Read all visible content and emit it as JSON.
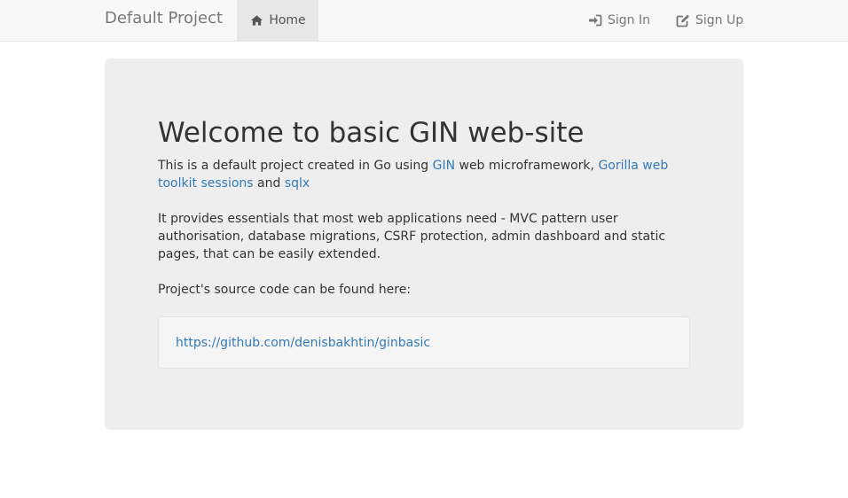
{
  "navbar": {
    "brand": "Default Project",
    "home_label": "Home",
    "home_icon": "home-icon",
    "signin_label": "Sign In",
    "signin_icon": "sign-in-icon",
    "signup_label": "Sign Up",
    "signup_icon": "edit-icon"
  },
  "jumbotron": {
    "title": "Welcome to basic GIN web-site",
    "p1": {
      "before": "This is a default project created in Go using ",
      "link1": "GIN",
      "middle": " web microframework, ",
      "link2": "Gorilla web toolkit sessions",
      "and": " and ",
      "link3": "sqlx"
    },
    "p2": "It provides essentials that most web applications need - MVC pattern user authorisation, database migrations, CSRF protection, admin dashboard and static pages, that can be easily extended.",
    "p3": "Project's source code can be found here:",
    "source_link": "https://github.com/denisbakhtin/ginbasic"
  },
  "colors": {
    "link": "#337ab7",
    "navbar_bg": "#f8f8f8",
    "jumbotron_bg": "#eeeeee"
  }
}
